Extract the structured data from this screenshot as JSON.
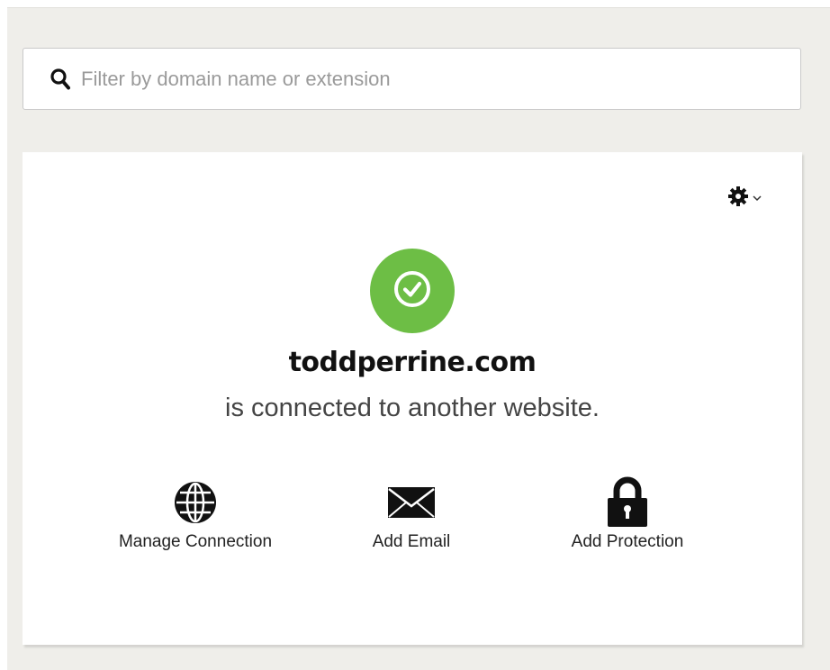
{
  "search": {
    "placeholder": "Filter by domain name or extension",
    "icon": "search-icon"
  },
  "card": {
    "settings_icon": "gear-icon",
    "status_icon": "check-circle-icon",
    "status_color": "#6dbe45",
    "domain": "toddperrine.com",
    "status_text": "is connected to another website.",
    "actions": [
      {
        "label": "Manage Connection",
        "icon": "globe-icon"
      },
      {
        "label": "Add Email",
        "icon": "envelope-icon"
      },
      {
        "label": "Add Protection",
        "icon": "lock-icon"
      }
    ]
  }
}
